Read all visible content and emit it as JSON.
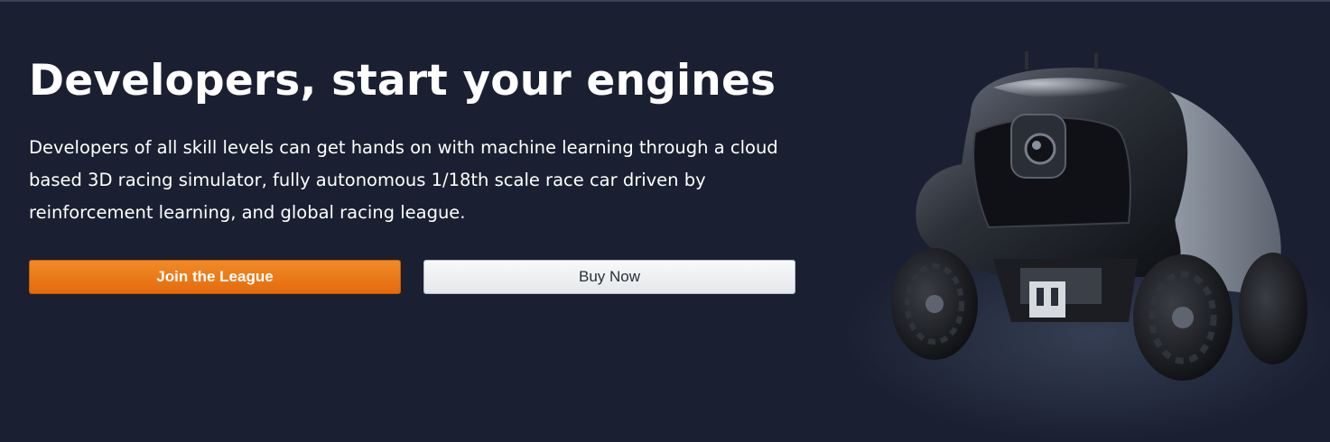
{
  "hero": {
    "title": "Developers, start your engines",
    "description": "Developers of all skill levels can get hands on with machine learning through a cloud based 3D racing simulator, fully autonomous 1/18th scale race car driven by reinforcement learning, and global racing league.",
    "primary_button": "Join the League",
    "secondary_button": "Buy Now"
  },
  "colors": {
    "background": "#1a2031",
    "primary_button": "#ed7a18",
    "secondary_button": "#eef0f2"
  },
  "image": {
    "subject": "race-car-image"
  }
}
